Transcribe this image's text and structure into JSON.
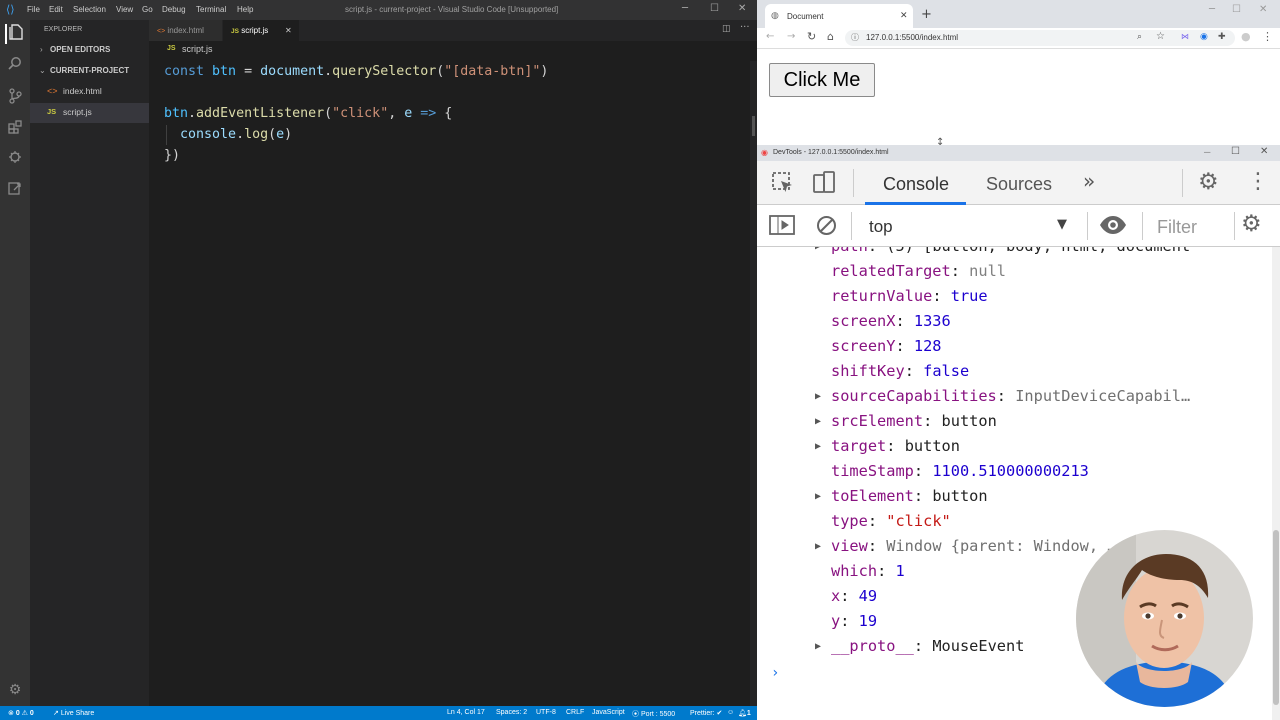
{
  "vscode": {
    "menu": [
      "File",
      "Edit",
      "Selection",
      "View",
      "Go",
      "Debug",
      "Terminal",
      "Help"
    ],
    "window_title": "script.js - current-project - Visual Studio Code [Unsupported]",
    "sidebar": {
      "title": "EXPLORER",
      "open_editors": "OPEN EDITORS",
      "project": "CURRENT-PROJECT",
      "files": [
        "index.html",
        "script.js"
      ]
    },
    "tabs": [
      "index.html",
      "script.js"
    ],
    "breadcrumb": "script.js",
    "code": [
      "const btn = document.querySelector(\"[data-btn]\")",
      "",
      "btn.addEventListener(\"click\", e => {",
      "  console.log(e)",
      "})"
    ],
    "statusbar": {
      "problems": "0",
      "warnings": "0",
      "live_share": "Live Share",
      "position": "Ln 4, Col 17",
      "spaces": "Spaces: 2",
      "encoding": "UTF-8",
      "eol": "CRLF",
      "language": "JavaScript",
      "port": "Port : 5500",
      "prettier": "Prettier: ✔",
      "notifications": "1"
    }
  },
  "browser": {
    "tab_title": "Document",
    "url": "127.0.0.1:5500/index.html",
    "page_button": "Click Me"
  },
  "devtools": {
    "title": "DevTools - 127.0.0.1:5500/index.html",
    "tabs": [
      "Console",
      "Sources"
    ],
    "context": "top",
    "filter_placeholder": "Filter",
    "rows": [
      {
        "key": "path",
        "value": "(5) [button, body, html, document",
        "expandable": true
      },
      {
        "key": "relatedTarget",
        "value": "null",
        "expandable": false
      },
      {
        "key": "returnValue",
        "value": "true",
        "expandable": false
      },
      {
        "key": "screenX",
        "value": "1336",
        "expandable": false
      },
      {
        "key": "screenY",
        "value": "128",
        "expandable": false
      },
      {
        "key": "shiftKey",
        "value": "false",
        "expandable": false
      },
      {
        "key": "sourceCapabilities",
        "value": "InputDeviceCapabil…",
        "expandable": true
      },
      {
        "key": "srcElement",
        "value": "button",
        "expandable": true
      },
      {
        "key": "target",
        "value": "button",
        "expandable": true
      },
      {
        "key": "timeStamp",
        "value": "1100.510000000213",
        "expandable": false
      },
      {
        "key": "toElement",
        "value": "button",
        "expandable": true
      },
      {
        "key": "type",
        "value": "\"click\"",
        "expandable": false
      },
      {
        "key": "view",
        "value": "Window {parent: Window, …",
        "expandable": true
      },
      {
        "key": "which",
        "value": "1",
        "expandable": false
      },
      {
        "key": "x",
        "value": "49",
        "expandable": false
      },
      {
        "key": "y",
        "value": "19",
        "expandable": false
      },
      {
        "key": "__proto__",
        "value": "MouseEvent",
        "expandable": true
      }
    ]
  }
}
